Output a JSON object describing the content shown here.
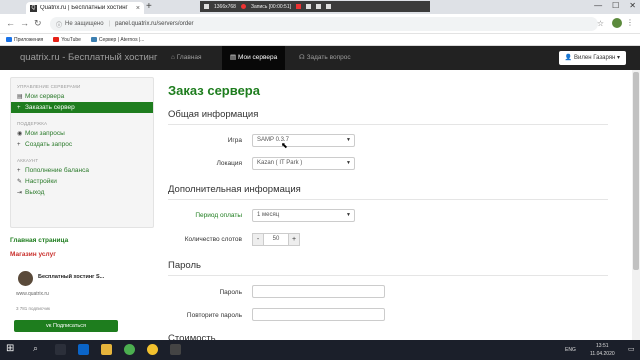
{
  "browser": {
    "tab_title": "Quatrix.ru | Бесплатный хостинг",
    "new_tab": "+",
    "recorder": {
      "resolution": "1366x768",
      "status": "Запись [00:00:51]"
    },
    "window_controls": [
      "—",
      "☐",
      "✕"
    ],
    "security_label": "Не защищено",
    "url": "panel.quatrix.ru/servers/order"
  },
  "bookmarks": [
    {
      "label": "Приложения",
      "color": "#1a73e8"
    },
    {
      "label": "YouTube",
      "color": "#e62117"
    },
    {
      "label": "Сервер | Aternos |...",
      "color": "#3c7fb1"
    }
  ],
  "site_nav": {
    "brand": "quatrix.ru - Бесплатный хостинг",
    "links": [
      {
        "label": "Главная",
        "icon": "home-icon"
      },
      {
        "label": "Мои сервера",
        "icon": "server-icon",
        "active": true
      },
      {
        "label": "Задать вопрос",
        "icon": "headset-icon"
      }
    ],
    "user": "Вилен Газарян"
  },
  "sidebar": {
    "sections": [
      {
        "heading": "УПРАВЛЕНИЕ СЕРВЕРАМИ",
        "items": [
          {
            "label": "Мои сервера",
            "icon": "list-icon"
          },
          {
            "label": "Заказать сервер",
            "icon": "plus-icon",
            "active": true
          }
        ]
      },
      {
        "heading": "ПОДДЕРЖКА",
        "items": [
          {
            "label": "Мои запросы",
            "icon": "chat-icon"
          },
          {
            "label": "Создать запрос",
            "icon": "plus-icon"
          }
        ]
      },
      {
        "heading": "АККАУНТ",
        "items": [
          {
            "label": "Пополнение баланса",
            "icon": "plus-icon"
          },
          {
            "label": "Настройки",
            "icon": "wrench-icon"
          },
          {
            "label": "Выход",
            "icon": "exit-icon"
          }
        ]
      }
    ],
    "home_link": "Главная страница",
    "shop_link": "Магазин услуг"
  },
  "vk_widget": {
    "name": "Бесплатный хостинг S...",
    "site": "www.quatrix.ru",
    "subscribers": "3 781 подписчик",
    "button": "Подписаться"
  },
  "main": {
    "title": "Заказ сервера",
    "general": {
      "heading": "Общая информация",
      "game_label": "Игра",
      "game_value": "SAMP 0.3.7",
      "location_label": "Локация",
      "location_value": "Kazan ( IT Park )"
    },
    "extra": {
      "heading": "Дополнительная информация",
      "period_label": "Период оплаты",
      "period_value": "1 месяц",
      "slots_label": "Количество слотов",
      "slots_value": "50",
      "minus": "-",
      "plus": "+"
    },
    "password": {
      "heading": "Пароль",
      "password_label": "Пароль",
      "repeat_label": "Повторите пароль"
    },
    "cost_heading": "Стоимость"
  },
  "taskbar": {
    "language": "ENG",
    "time": "13:51",
    "date": "11.04.2020"
  },
  "colors": {
    "accent_green": "#1e7d1e",
    "navbar": "#222222"
  }
}
